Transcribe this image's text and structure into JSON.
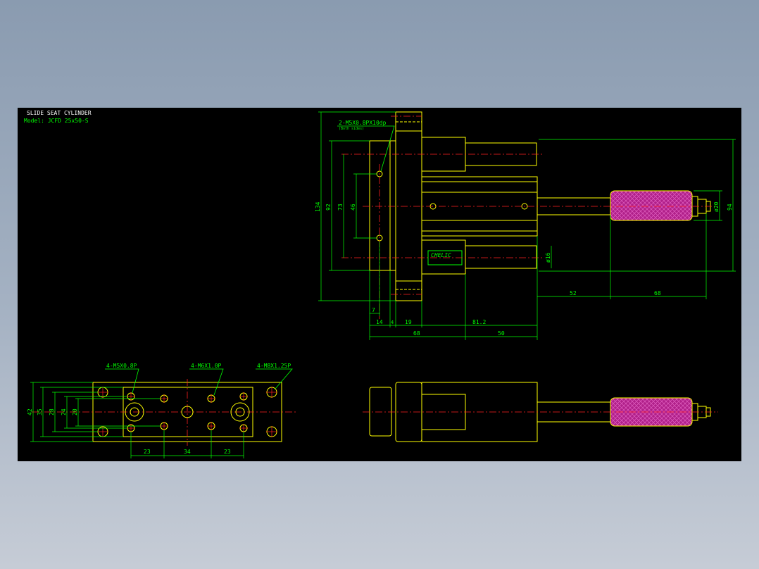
{
  "drawing": {
    "title": "SLIDE SEAT CYLINDER",
    "model": "Model: JCFD 25x50-S",
    "brand": "CHELIC",
    "colors": {
      "background": "#000000",
      "outline": "#ffff00",
      "dimension": "#00ff00",
      "centerline": "#ff2020",
      "title": "#ffffff",
      "hatch": "#b0208a"
    }
  },
  "top_view": {
    "callouts": {
      "m5x08": "4-M5X0.8P",
      "m6x10": "4-M6X1.0P",
      "m8x125": "4-M8X1.25P"
    },
    "dims": {
      "d42": "42",
      "d35": "35",
      "d28": "28",
      "d24": "24",
      "d20": "20",
      "d23a": "23",
      "d34": "34",
      "d23b": "23"
    }
  },
  "side_view": {
    "callouts": {
      "port": "2-M5X0.8PX10dp",
      "port_sub": "(Both sides)"
    },
    "dims": {
      "d134": "134",
      "d92": "92",
      "d73": "73",
      "d46": "46",
      "d7": "7",
      "d14": "14",
      "d4": "4",
      "d19": "19",
      "d81_2": "81.2",
      "d68": "68",
      "d50": "50",
      "d52": "52",
      "d68b": "68",
      "d94": "94",
      "phi20": "ø20",
      "phi16": "ø16"
    }
  }
}
